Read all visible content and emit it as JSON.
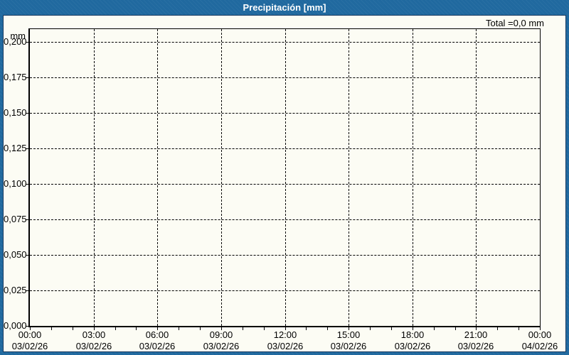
{
  "window": {
    "title": "Precipitación [mm]"
  },
  "header": {
    "total_label": "Total =0,0 mm"
  },
  "y_axis": {
    "unit": "mm",
    "ticks": [
      "0,200",
      "0,175",
      "0,150",
      "0,125",
      "0,100",
      "0,075",
      "0,050",
      "0,025",
      "0,000"
    ]
  },
  "x_axis": {
    "labels": [
      {
        "time": "00:00",
        "date": "03/02/26"
      },
      {
        "time": "03:00",
        "date": "03/02/26"
      },
      {
        "time": "06:00",
        "date": "03/02/26"
      },
      {
        "time": "09:00",
        "date": "03/02/26"
      },
      {
        "time": "12:00",
        "date": "03/02/26"
      },
      {
        "time": "15:00",
        "date": "03/02/26"
      },
      {
        "time": "18:00",
        "date": "03/02/26"
      },
      {
        "time": "21:00",
        "date": "03/02/26"
      },
      {
        "time": "00:00",
        "date": "04/02/26"
      }
    ],
    "minor_tick_hours": 1,
    "major_step_hours": 3
  },
  "colors": {
    "frame_blue": "#20699f",
    "frame_border_navy": "#17395f",
    "panel_background": "#fcfcf4",
    "grid_and_text": "#000000",
    "title_text": "#ffffff"
  },
  "chart_data": {
    "type": "bar",
    "title": "Precipitación [mm]",
    "ylabel": "mm",
    "ylim": [
      0,
      0.21
    ],
    "y_ticks": [
      0.0,
      0.025,
      0.05,
      0.075,
      0.1,
      0.125,
      0.15,
      0.175,
      0.2
    ],
    "x": [
      "03/02/26 00:00",
      "03/02/26 03:00",
      "03/02/26 06:00",
      "03/02/26 09:00",
      "03/02/26 12:00",
      "03/02/26 15:00",
      "03/02/26 18:00",
      "03/02/26 21:00",
      "04/02/26 00:00"
    ],
    "series": [
      {
        "name": "Precipitación",
        "values": [
          0,
          0,
          0,
          0,
          0,
          0,
          0,
          0,
          0
        ]
      }
    ],
    "total_mm": 0.0,
    "grid": true,
    "grid_style": "dashed",
    "legend_position": "none",
    "annotations": [
      "Total =0,0 mm"
    ]
  }
}
